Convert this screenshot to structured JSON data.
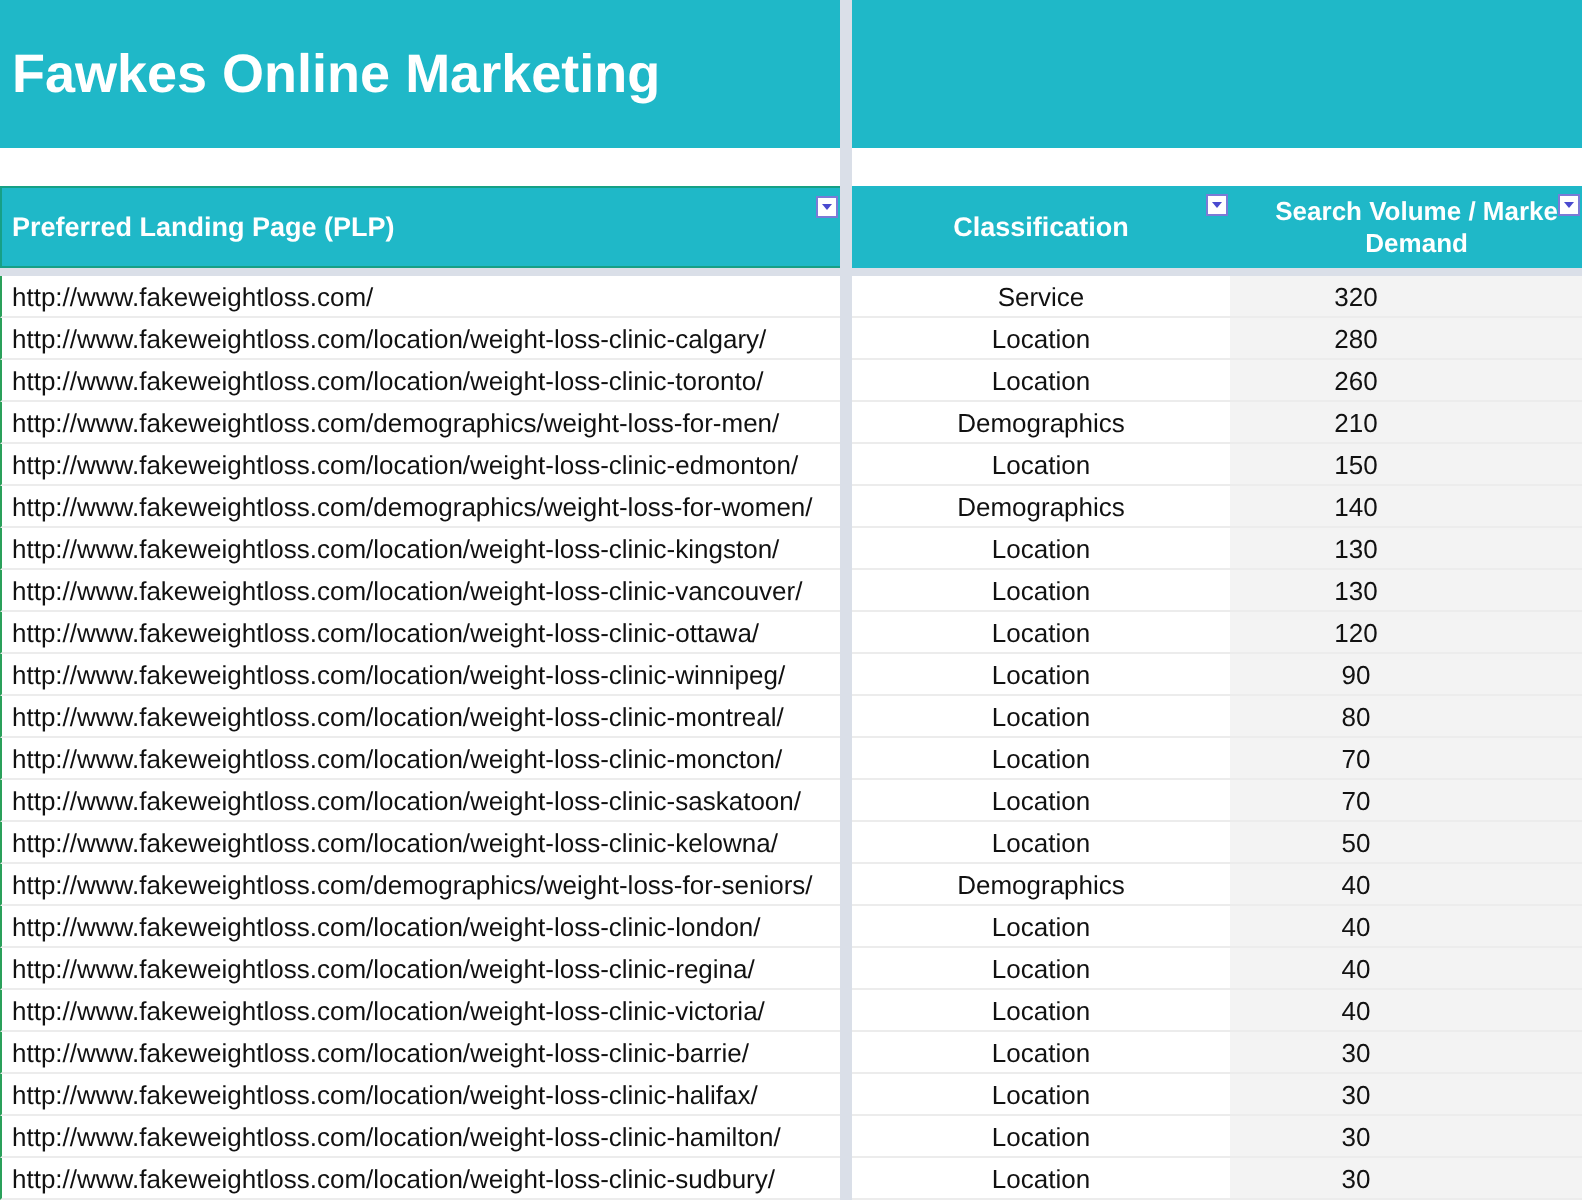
{
  "title": "Fawkes Online Marketing",
  "columns": [
    {
      "label": "Preferred Landing Page (PLP)",
      "filter": true
    },
    {
      "label": "Classification",
      "filter": true
    },
    {
      "label": "Search Volume / Marke\nDemand",
      "filter": true
    }
  ],
  "rows": [
    [
      "http://www.fakeweightloss.com/",
      "Service",
      "320"
    ],
    [
      "http://www.fakeweightloss.com/location/weight-loss-clinic-calgary/",
      "Location",
      "280"
    ],
    [
      "http://www.fakeweightloss.com/location/weight-loss-clinic-toronto/",
      "Location",
      "260"
    ],
    [
      "http://www.fakeweightloss.com/demographics/weight-loss-for-men/",
      "Demographics",
      "210"
    ],
    [
      "http://www.fakeweightloss.com/location/weight-loss-clinic-edmonton/",
      "Location",
      "150"
    ],
    [
      "http://www.fakeweightloss.com/demographics/weight-loss-for-women/",
      "Demographics",
      "140"
    ],
    [
      "http://www.fakeweightloss.com/location/weight-loss-clinic-kingston/",
      "Location",
      "130"
    ],
    [
      "http://www.fakeweightloss.com/location/weight-loss-clinic-vancouver/",
      "Location",
      "130"
    ],
    [
      "http://www.fakeweightloss.com/location/weight-loss-clinic-ottawa/",
      "Location",
      "120"
    ],
    [
      "http://www.fakeweightloss.com/location/weight-loss-clinic-winnipeg/",
      "Location",
      "90"
    ],
    [
      "http://www.fakeweightloss.com/location/weight-loss-clinic-montreal/",
      "Location",
      "80"
    ],
    [
      "http://www.fakeweightloss.com/location/weight-loss-clinic-moncton/",
      "Location",
      "70"
    ],
    [
      "http://www.fakeweightloss.com/location/weight-loss-clinic-saskatoon/",
      "Location",
      "70"
    ],
    [
      "http://www.fakeweightloss.com/location/weight-loss-clinic-kelowna/",
      "Location",
      "50"
    ],
    [
      "http://www.fakeweightloss.com/demographics/weight-loss-for-seniors/",
      "Demographics",
      "40"
    ],
    [
      "http://www.fakeweightloss.com/location/weight-loss-clinic-london/",
      "Location",
      "40"
    ],
    [
      "http://www.fakeweightloss.com/location/weight-loss-clinic-regina/",
      "Location",
      "40"
    ],
    [
      "http://www.fakeweightloss.com/location/weight-loss-clinic-victoria/",
      "Location",
      "40"
    ],
    [
      "http://www.fakeweightloss.com/location/weight-loss-clinic-barrie/",
      "Location",
      "30"
    ],
    [
      "http://www.fakeweightloss.com/location/weight-loss-clinic-halifax/",
      "Location",
      "30"
    ],
    [
      "http://www.fakeweightloss.com/location/weight-loss-clinic-hamilton/",
      "Location",
      "30"
    ],
    [
      "http://www.fakeweightloss.com/location/weight-loss-clinic-sudbury/",
      "Location",
      "30"
    ]
  ]
}
